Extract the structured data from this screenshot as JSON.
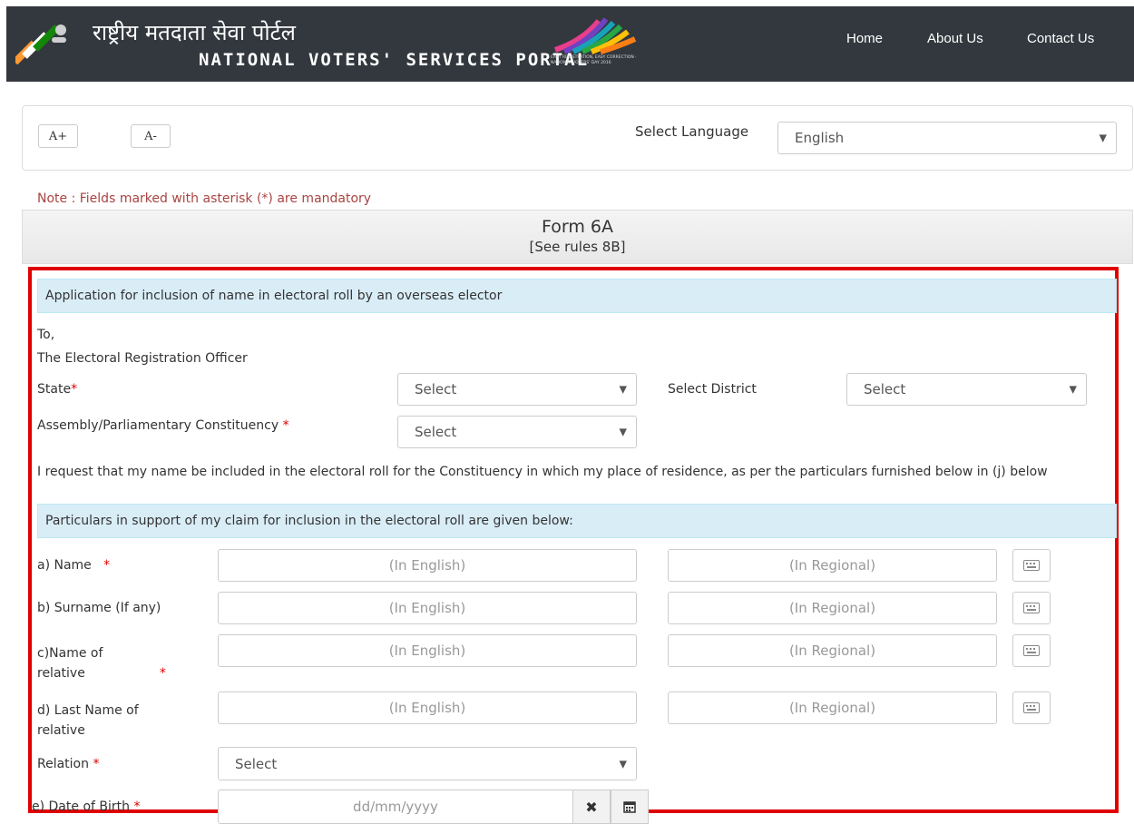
{
  "header": {
    "hindi_title": "राष्ट्रीय मतदाता सेवा पोर्टल",
    "english_title": "NATIONAL VOTERS' SERVICES PORTAL",
    "badge_caption": "EASY REGISTRATION, EASY CORRECTION · NATIONAL VOTERS' DAY 2016",
    "nav": {
      "home": "Home",
      "about": "About Us",
      "contact": "Contact Us"
    }
  },
  "toolbar": {
    "font_increase": "A+",
    "font_decrease": "A-",
    "language_label": "Select Language",
    "language_value": "English"
  },
  "note": "Note : Fields marked with asterisk (*) are mandatory",
  "form": {
    "title": "Form 6A",
    "subtitle": "[See rules 8B]",
    "application_heading": "Application for inclusion of name in electoral roll by an overseas elector",
    "to": "To,",
    "addressee": "The Electoral Registration Officer",
    "state_label": "State",
    "state_value": "Select",
    "district_label": "Select District",
    "district_value": "Select",
    "constituency_label": "Assembly/Parliamentary Constituency",
    "constituency_value": "Select",
    "request_text": "I request that my name be included in the electoral roll for the Constituency in which my place of residence, as per the particulars furnished below in (j) below",
    "particulars_heading": "Particulars in support of my claim for inclusion in the electoral roll are given below:",
    "rows": {
      "name": {
        "label": "a) Name"
      },
      "surname": {
        "label": "b) Surname (If any)"
      },
      "relative_name": {
        "label_line1": "c)Name of",
        "label_line2": "relative"
      },
      "relative_last_name": {
        "label_line1": "d) Last Name of",
        "label_line2": "relative"
      }
    },
    "placeholder_english": "(In English)",
    "placeholder_regional": "(In Regional)",
    "relation_label": "Relation",
    "relation_value": "Select",
    "dob_label": "e) Date of Birth",
    "dob_placeholder": "dd/mm/yyyy",
    "required_mark": "*"
  }
}
